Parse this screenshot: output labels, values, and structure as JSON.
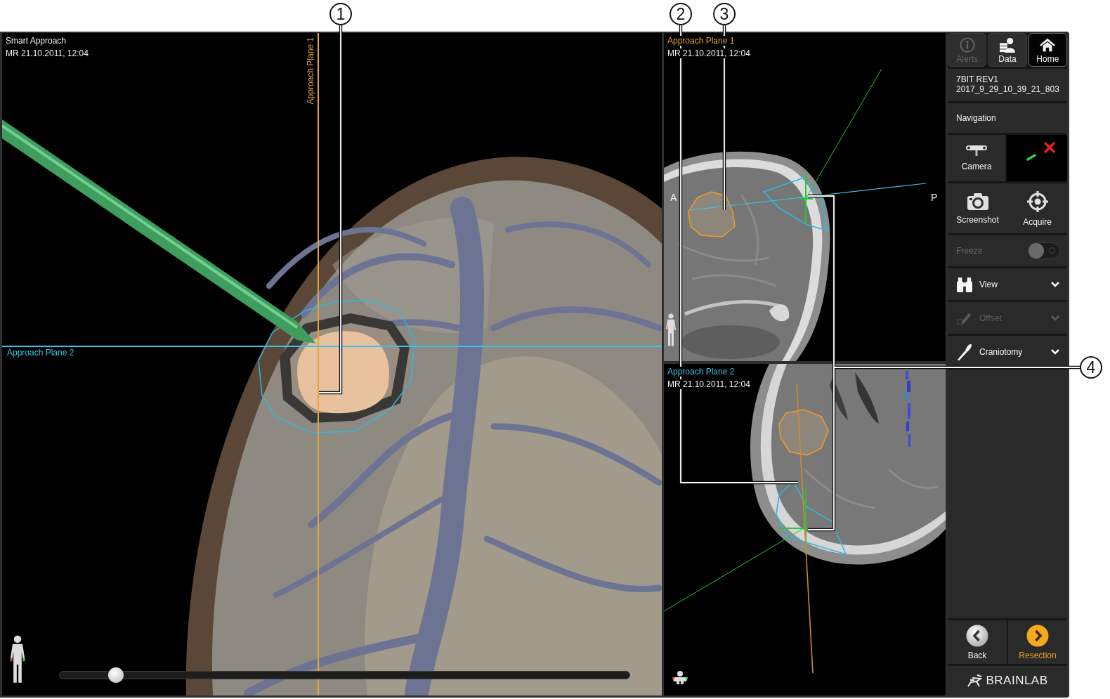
{
  "callouts": [
    "1",
    "2",
    "3",
    "4"
  ],
  "main_view": {
    "title": "Smart Approach",
    "subtitle": "MR 21.10.2011, 12:04",
    "planes": [
      {
        "label": "Approach Plane 1",
        "kind": "vertical",
        "color": "#e8a33a"
      },
      {
        "label": "Approach Plane 2",
        "kind": "horizontal",
        "color": "#3cc3e8"
      }
    ],
    "slider": {
      "level": 0.1
    }
  },
  "slice_views": [
    {
      "kind": "sagittal",
      "title": "Approach Plane 1",
      "color": "#e8a33a",
      "subtitle": "MR 21.10.2011, 12:04",
      "orientation_labels": [
        "A",
        "P"
      ]
    },
    {
      "kind": "axial",
      "title": "Approach Plane 2",
      "color": "#3cc3e8",
      "subtitle": "MR 21.10.2011, 12:04"
    }
  ],
  "sidebar": {
    "tabs": [
      {
        "label": "Alerts",
        "selected": false,
        "disabled": true
      },
      {
        "label": "Data",
        "selected": false,
        "disabled": false
      },
      {
        "label": "Home",
        "selected": true,
        "disabled": false
      }
    ],
    "patient": {
      "name": "7BIT REV1",
      "record": "2017_9_29_10_39_21_803"
    },
    "section": "Navigation",
    "camera": {
      "label": "Camera"
    },
    "actions": [
      {
        "label": "Screenshot"
      },
      {
        "label": "Acquire"
      }
    ],
    "freeze": {
      "label": "Freeze",
      "on": false,
      "disabled": true
    },
    "menu": [
      {
        "label": "View",
        "disabled": false
      },
      {
        "label": "Offset",
        "disabled": true
      },
      {
        "label": "Craniotomy",
        "disabled": false
      }
    ],
    "nav": [
      {
        "label": "Back",
        "kind": "back"
      },
      {
        "label": "Resection",
        "kind": "next"
      }
    ],
    "logo": "BRAINLAB"
  }
}
